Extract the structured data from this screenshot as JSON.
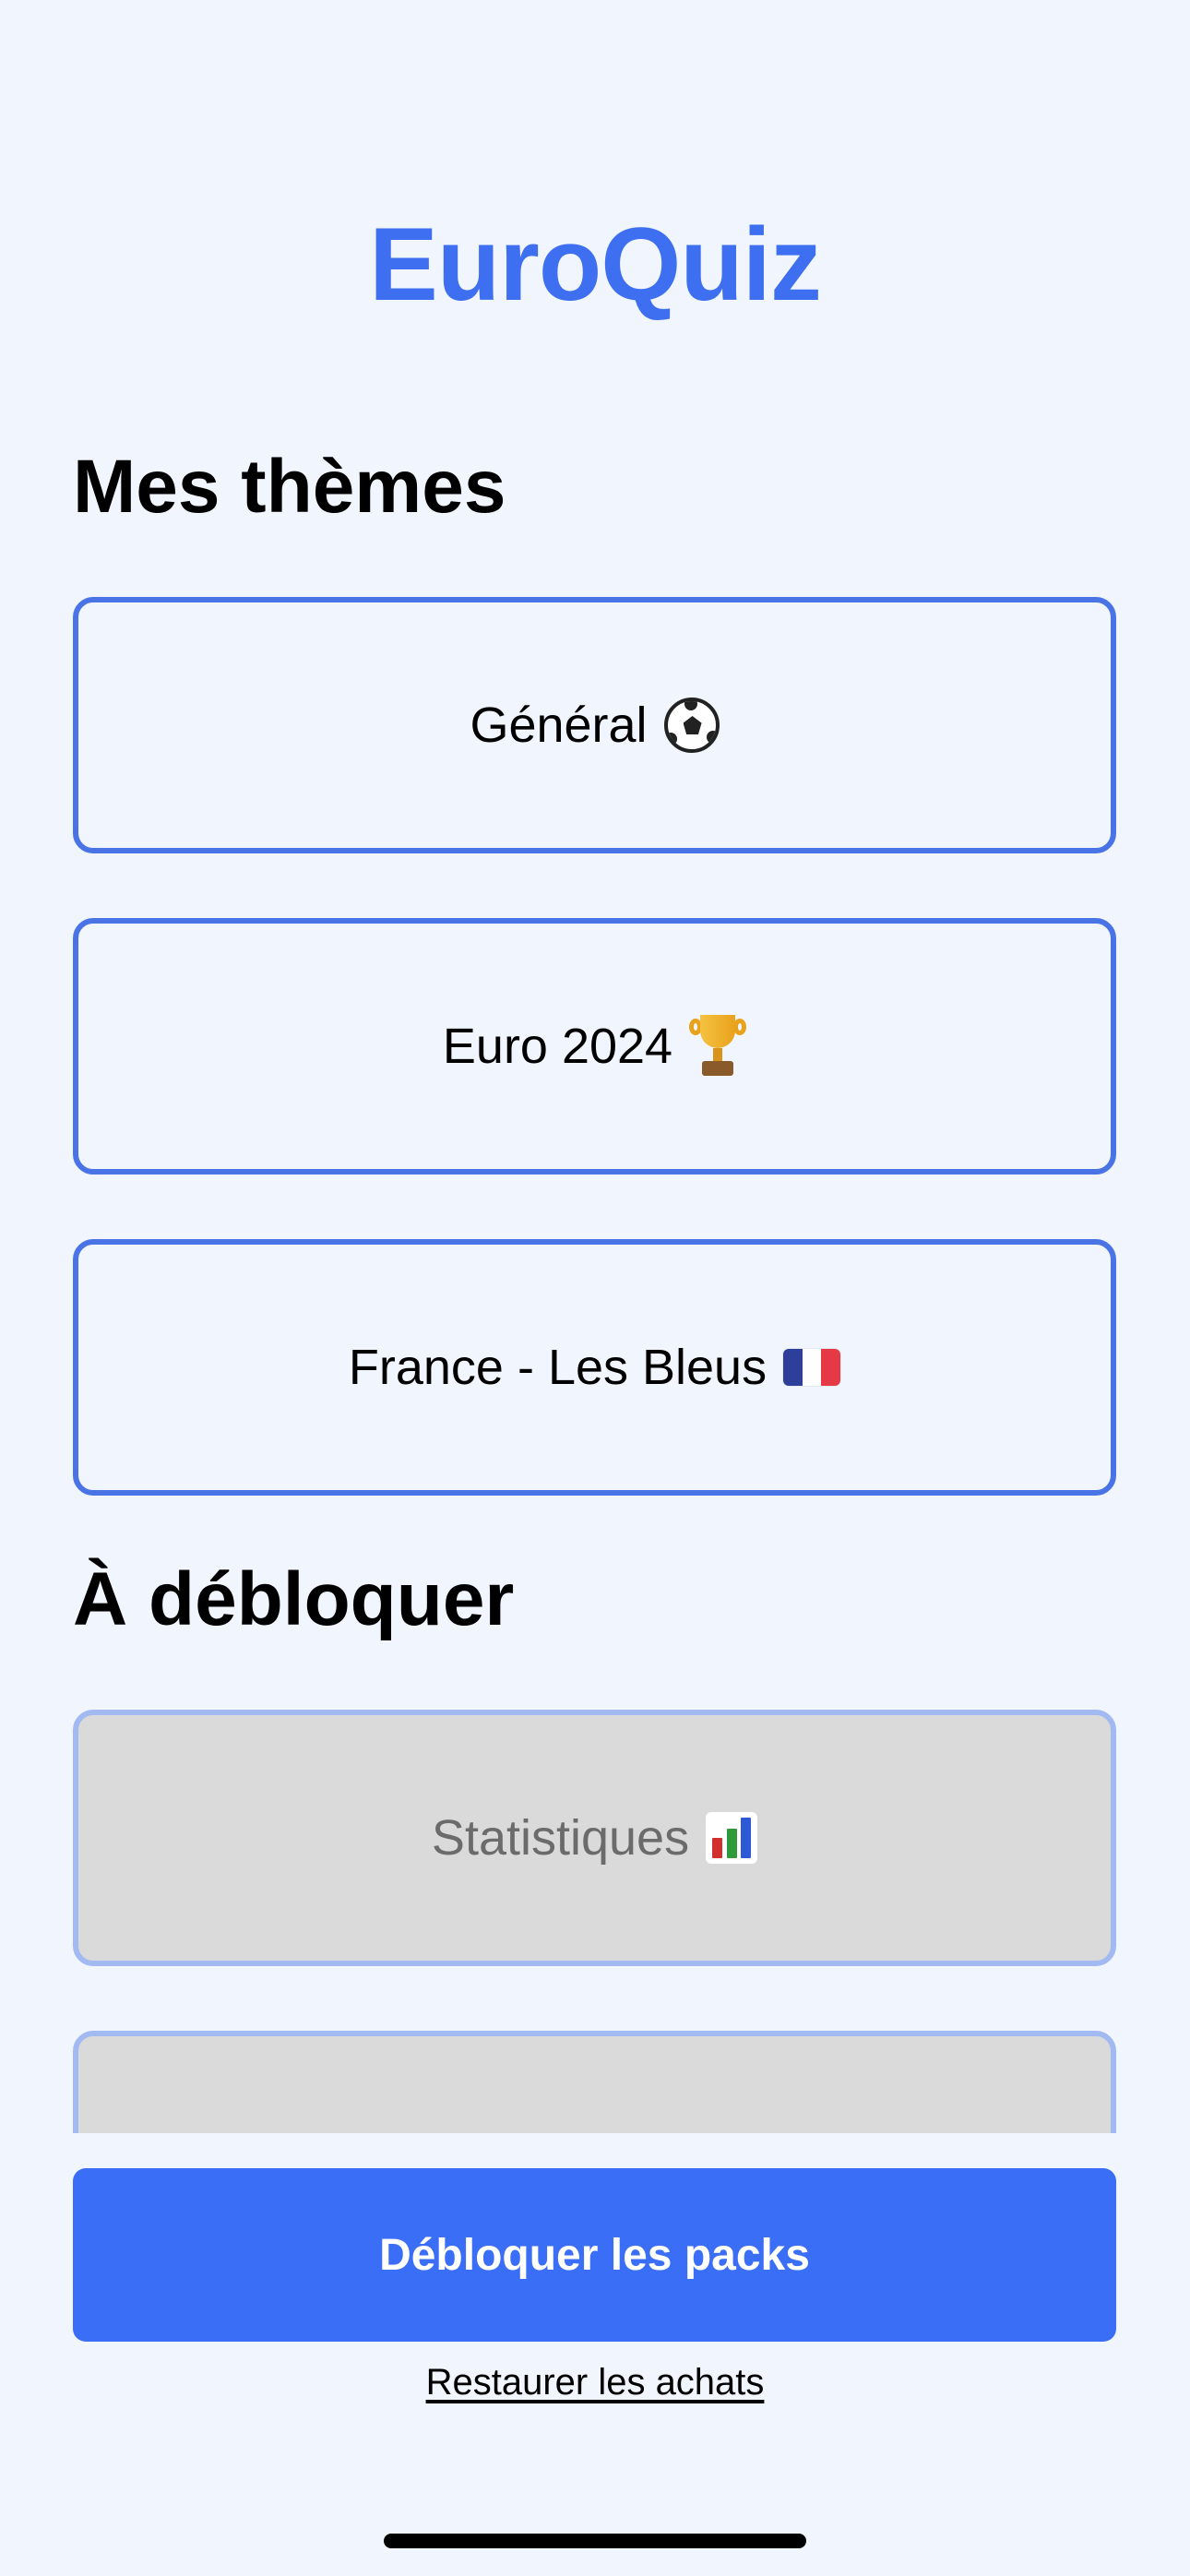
{
  "app": {
    "title": "EuroQuiz"
  },
  "my_themes": {
    "heading": "Mes thèmes",
    "items": [
      {
        "label": "Général",
        "icon": "soccer-ball-icon"
      },
      {
        "label": "Euro 2024",
        "icon": "trophy-icon"
      },
      {
        "label": "France - Les Bleus",
        "icon": "france-flag-icon"
      }
    ]
  },
  "locked_themes": {
    "heading": "À débloquer",
    "items": [
      {
        "label": "Statistiques",
        "icon": "bar-chart-icon"
      },
      {
        "label": "",
        "icon": ""
      }
    ]
  },
  "actions": {
    "unlock_label": "Débloquer les packs",
    "restore_label": "Restaurer les achats"
  },
  "colors": {
    "accent": "#3b6ef6",
    "title": "#3e6ff0",
    "card_border": "#4a74e6",
    "locked_border": "#a3b9f2",
    "locked_fill": "#dadada",
    "background": "#f1f5fe"
  }
}
